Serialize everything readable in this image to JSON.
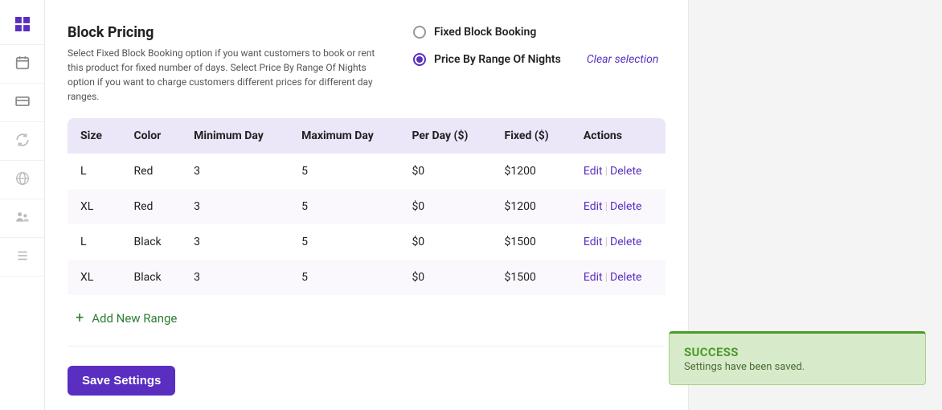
{
  "header": {
    "title": "Block Pricing",
    "description": "Select Fixed Block Booking option if you want customers to book or rent this product for fixed number of days. Select Price By Range Of Nights option if you want to charge customers different prices for different day ranges."
  },
  "radios": {
    "fixed_label": "Fixed Block Booking",
    "range_label": "Price By Range Of Nights",
    "clear_label": "Clear selection"
  },
  "table": {
    "headers": {
      "size": "Size",
      "color": "Color",
      "min": "Minimum Day",
      "max": "Maximum Day",
      "perday": "Per Day ($)",
      "fixed": "Fixed ($)",
      "actions": "Actions"
    },
    "rows": [
      {
        "size": "L",
        "color": "Red",
        "min": "3",
        "max": "5",
        "perday": "$0",
        "fixed": "$1200"
      },
      {
        "size": "XL",
        "color": "Red",
        "min": "3",
        "max": "5",
        "perday": "$0",
        "fixed": "$1200"
      },
      {
        "size": "L",
        "color": "Black",
        "min": "3",
        "max": "5",
        "perday": "$0",
        "fixed": "$1500"
      },
      {
        "size": "XL",
        "color": "Black",
        "min": "3",
        "max": "5",
        "perday": "$0",
        "fixed": "$1500"
      }
    ],
    "edit_label": "Edit",
    "delete_label": "Delete"
  },
  "add_range_label": "Add New Range",
  "save_label": "Save Settings",
  "toast": {
    "title": "SUCCESS",
    "message": "Settings have been saved."
  }
}
